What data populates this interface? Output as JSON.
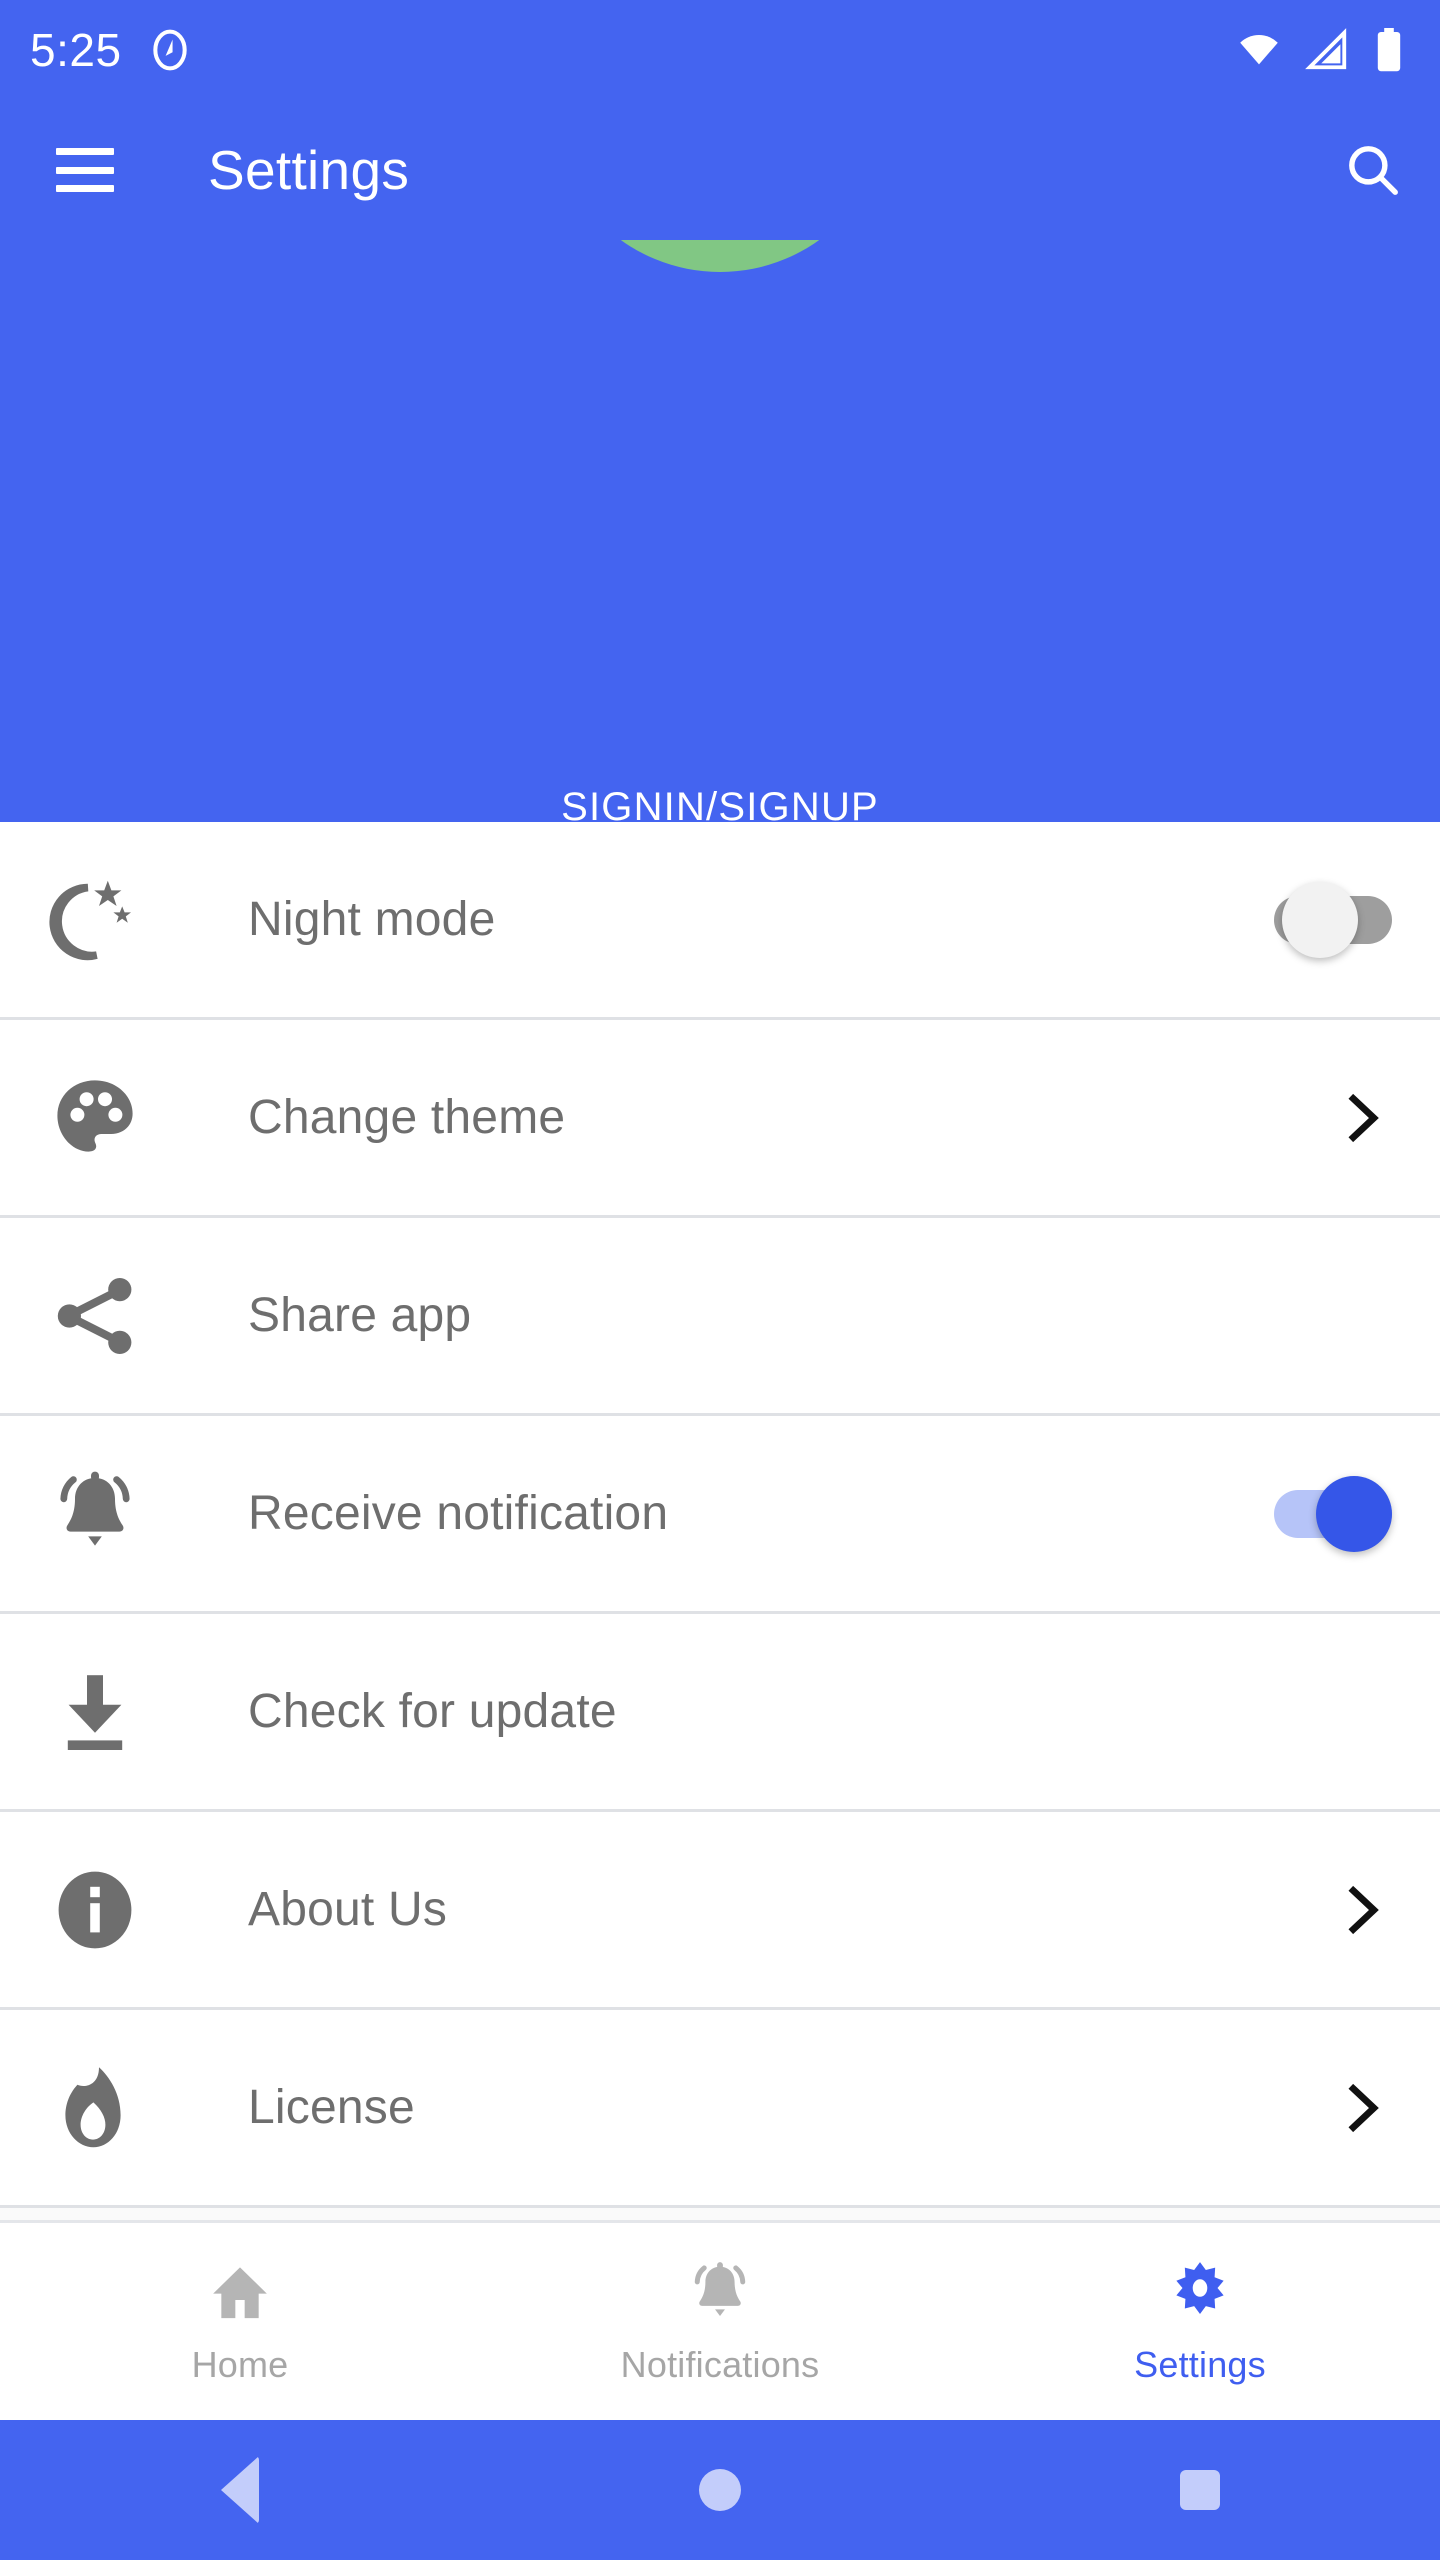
{
  "status_bar": {
    "time": "5:25",
    "left_icons": [
      "android-q-icon"
    ],
    "right_icons": [
      "wifi-icon",
      "cellular-signal-icon",
      "battery-icon"
    ]
  },
  "app_bar": {
    "menu_icon": "hamburger-menu-icon",
    "title": "Settings",
    "search_icon": "search-icon"
  },
  "header": {
    "avatar_icon": "avatar-placeholder-circle",
    "avatar_color": "#81c784",
    "background_color": "#4464f0",
    "signin_label": "SIGNIN/SIGNUP"
  },
  "settings_rows": [
    {
      "label": "Night mode",
      "icon": "moon-stars-icon",
      "trailing": "switch",
      "switch_state": "off"
    },
    {
      "label": "Change theme",
      "icon": "palette-icon",
      "trailing": "chevron"
    },
    {
      "label": "Share app",
      "icon": "share-icon",
      "trailing": "none"
    },
    {
      "label": "Receive notification",
      "icon": "bell-active-icon",
      "trailing": "switch",
      "switch_state": "on"
    },
    {
      "label": "Check for update",
      "icon": "download-icon",
      "trailing": "none"
    },
    {
      "label": "About Us",
      "icon": "info-circle-icon",
      "trailing": "chevron"
    },
    {
      "label": "License",
      "icon": "flame-icon",
      "trailing": "chevron"
    }
  ],
  "bottom_nav": {
    "items": [
      {
        "label": "Home",
        "icon": "home-icon",
        "active": false
      },
      {
        "label": "Notifications",
        "icon": "bell-icon",
        "active": false
      },
      {
        "label": "Settings",
        "icon": "gear-icon",
        "active": true
      }
    ],
    "active_color": "#3f5ef0",
    "inactive_color": "#a6a6a6"
  },
  "system_nav": {
    "back_icon": "back-triangle-icon",
    "home_icon": "home-circle-icon",
    "recents_icon": "recents-square-icon"
  }
}
